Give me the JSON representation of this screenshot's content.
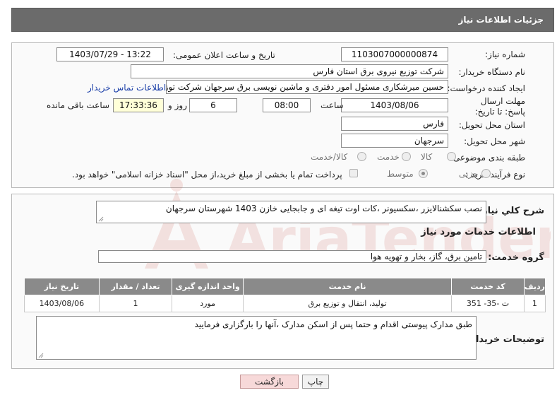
{
  "header": {
    "title": "جزئیات اطلاعات نیاز"
  },
  "fields": {
    "need_number_label": "شماره نیاز:",
    "need_number": "1103007000000874",
    "announce_label": "تاریخ و ساعت اعلان عمومی:",
    "announce_value": "1403/07/29 - 13:22",
    "buyer_org_label": "نام دستگاه خریدار:",
    "buyer_org": "شرکت توزیع نیروی برق استان فارس",
    "creator_label": "ایجاد کننده درخواست:",
    "creator": "حسین میرشکاری مسئول امور دفتری و ماشین نویسی برق سرجهان شرکت توز",
    "contact_link": "اطلاعات تماس خریدار",
    "deadline_label": "مهلت ارسال پاسخ: تا تاریخ:",
    "deadline_date": "1403/08/06",
    "time_label": "ساعت",
    "deadline_time": "08:00",
    "days_value": "6",
    "days_label": "روز و",
    "remaining_time": "17:33:36",
    "remaining_label": "ساعت باقی مانده",
    "province_label": "استان محل تحویل:",
    "province": "فارس",
    "city_label": "شهر محل تحویل:",
    "city": "سرجهان",
    "category_label": "طبقه بندی موضوعی:",
    "category_options": [
      "کالا",
      "خدمت",
      "کالا/خدمت"
    ],
    "process_label": "نوع فرآیند خرید :",
    "process_options": [
      "جزیی",
      "متوسط"
    ],
    "payment_note": "پرداخت تمام یا بخشی از مبلغ خرید،از محل \"اسناد خزانه اسلامی\" خواهد بود."
  },
  "summary": {
    "label": "شرح کلي نياز:",
    "text": "نصب سکشنالایزر ،سکسیونر ،کات اوت تیغه ای و جابجایی خازن 1403 شهرستان سرجهان"
  },
  "services": {
    "section_title": "اطلاعات خدمات مورد نیاز",
    "group_label": "گروه خدمت:",
    "group_value": "تامین برق، گاز، بخار و تهویه هوا",
    "columns": [
      "ردیف",
      "کد خدمت",
      "نام خدمت",
      "واحد اندازه گیری",
      "تعداد / مقدار",
      "تاریخ نیاز"
    ],
    "rows": [
      [
        "1",
        "ت -35- 351",
        "تولید، انتقال و توزیع برق",
        "مورد",
        "1",
        "1403/08/06"
      ]
    ]
  },
  "buyer_notes": {
    "label": "توضیحات خریدار:",
    "text": "طبق مدارک پیوستی اقدام و حتما پس از اسکن مدارک ،آنها را بارگزاری فرمایید"
  },
  "buttons": {
    "print": "چاپ",
    "back": "بازگشت"
  },
  "watermark": {
    "text": "AriaTender.net"
  }
}
